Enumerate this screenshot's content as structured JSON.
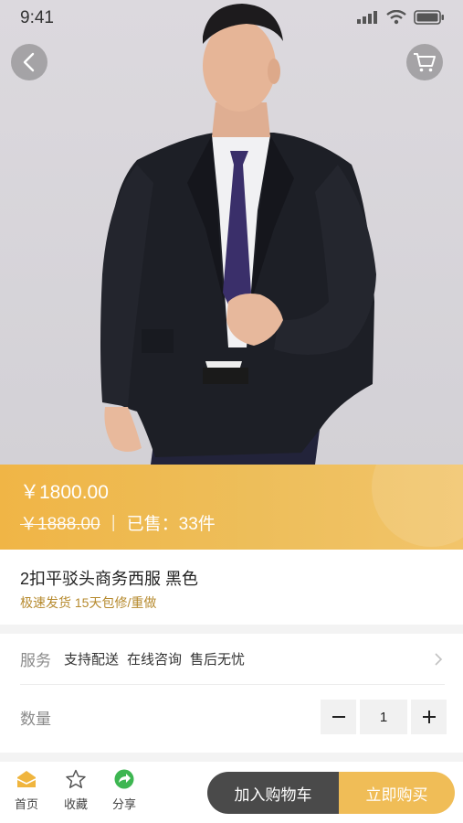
{
  "status_bar": {
    "time": "9:41"
  },
  "price": {
    "current": "￥1800.00",
    "original": "￥1888.00",
    "separator": "|",
    "sold": "已售：33件"
  },
  "product": {
    "title": "2扣平驳头商务西服 黑色",
    "tags": "极速发货 15天包修/重做"
  },
  "service": {
    "label": "服务",
    "items": [
      "支持配送",
      "在线咨询",
      "售后无忧"
    ]
  },
  "quantity": {
    "label": "数量",
    "value": "1",
    "decrement": "−",
    "increment": "+"
  },
  "bottom_nav": {
    "home": "首页",
    "favorite": "收藏",
    "share": "分享"
  },
  "actions": {
    "add_to_cart": "加入购物车",
    "buy_now": "立即购买"
  },
  "icons": [
    "back-icon",
    "cart-icon",
    "signal-icon",
    "wifi-icon",
    "battery-icon",
    "home-icon",
    "star-icon",
    "share-icon",
    "chevron-right-icon"
  ],
  "colors": {
    "accent": "#f0bd57",
    "price_banner": "#efb84e",
    "tag_text": "#b68a2e",
    "cart_button": "#4a4a4a"
  }
}
